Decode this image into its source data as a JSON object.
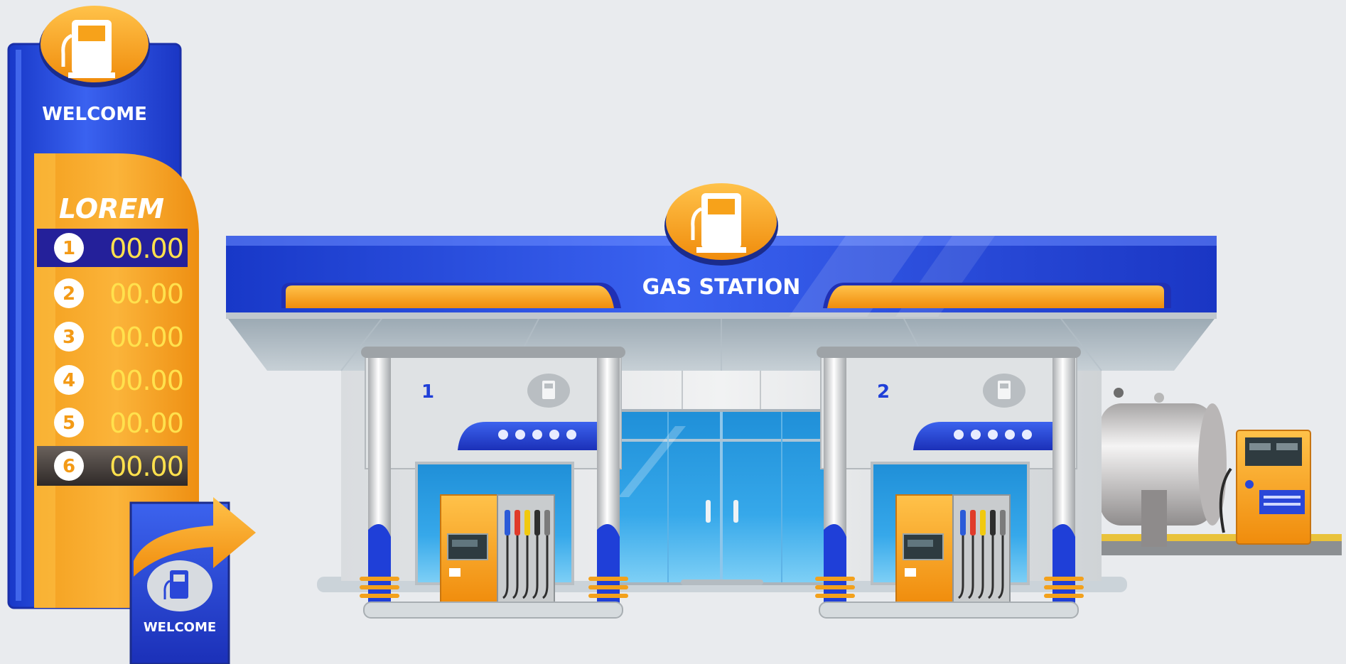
{
  "pylon": {
    "welcome_text": "WELCOME",
    "brand_text": "LOREM",
    "price_rows": [
      {
        "num": "1",
        "price": "00.00"
      },
      {
        "num": "2",
        "price": "00.00"
      },
      {
        "num": "3",
        "price": "00.00"
      },
      {
        "num": "4",
        "price": "00.00"
      },
      {
        "num": "5",
        "price": "00.00"
      },
      {
        "num": "6",
        "price": "00.00"
      }
    ]
  },
  "small_sign": {
    "welcome_text": "WELCOME"
  },
  "station": {
    "canopy_title": "GAS STATION",
    "bays": [
      {
        "number": "1"
      },
      {
        "number": "2"
      }
    ]
  },
  "colors": {
    "blue": "#1f3fd8",
    "blue_dark": "#1527a0",
    "orange": "#f7a21a",
    "orange_dark": "#e8860c",
    "price_digit": "#ffe14d",
    "background": "#e9ebee"
  }
}
